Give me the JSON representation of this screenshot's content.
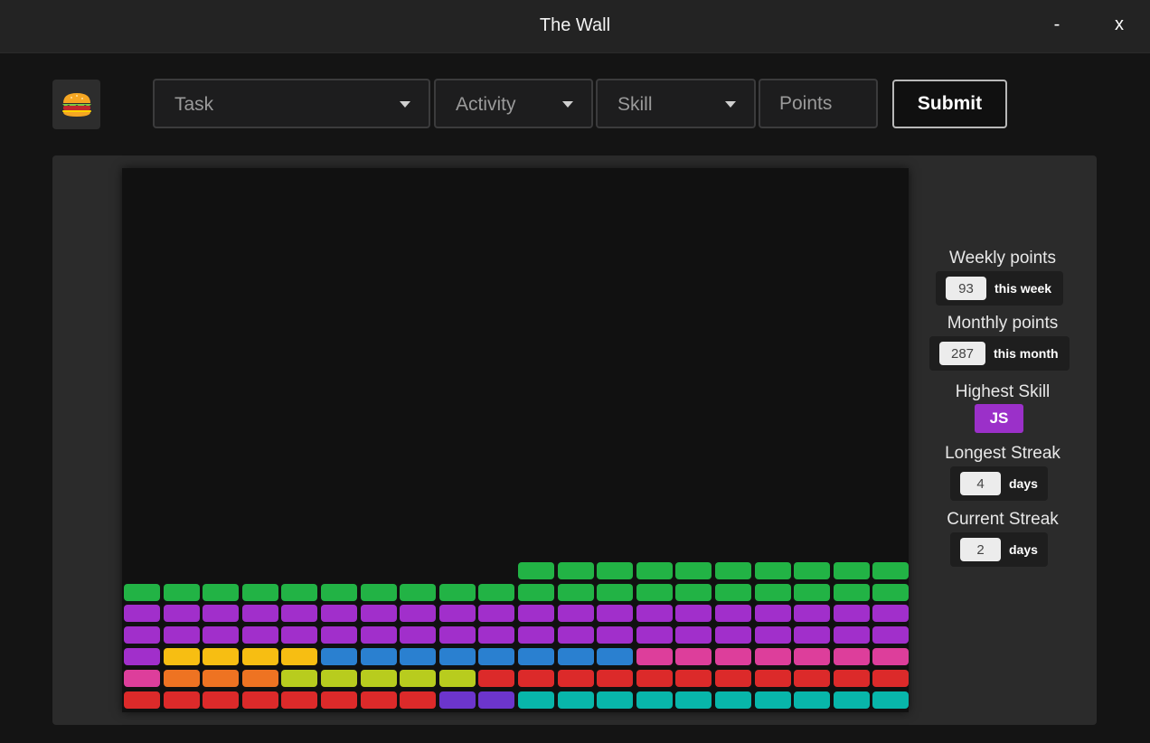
{
  "window": {
    "title": "The Wall",
    "minimize_label": "-",
    "close_label": "x"
  },
  "logo": {
    "icon": "burger-icon"
  },
  "form": {
    "task_label": "Task",
    "activity_label": "Activity",
    "skill_label": "Skill",
    "points_placeholder": "Points",
    "submit_label": "Submit"
  },
  "stats": {
    "weekly": {
      "label": "Weekly points",
      "value": "93",
      "unit": "this week"
    },
    "monthly": {
      "label": "Monthly points",
      "value": "287",
      "unit": "this month"
    },
    "highest_skill": {
      "label": "Highest Skill",
      "value": "JS",
      "color": "#9b30c9"
    },
    "longest_streak": {
      "label": "Longest Streak",
      "value": "4",
      "unit": "days"
    },
    "current_streak": {
      "label": "Current Streak",
      "value": "2",
      "unit": "days"
    }
  },
  "wall": {
    "columns": 20,
    "colors": {
      "G": "#22b345",
      "P": "#a12fcb",
      "Y": "#f7be12",
      "B": "#2a80d0",
      "K": "#dd3e9b",
      "O": "#ee7322",
      "L": "#b8cc1e",
      "R": "#dc2a2a",
      "V": "#6c35cc",
      "T": "#08b6aa"
    },
    "rows_bottom_to_top": [
      [
        "R",
        "R",
        "R",
        "R",
        "R",
        "R",
        "R",
        "R",
        "V",
        "V",
        "T",
        "T",
        "T",
        "T",
        "T",
        "T",
        "T",
        "T",
        "T",
        "T"
      ],
      [
        "K",
        "O",
        "O",
        "O",
        "L",
        "L",
        "L",
        "L",
        "L",
        "R",
        "R",
        "R",
        "R",
        "R",
        "R",
        "R",
        "R",
        "R",
        "R",
        "R"
      ],
      [
        "P",
        "Y",
        "Y",
        "Y",
        "Y",
        "B",
        "B",
        "B",
        "B",
        "B",
        "B",
        "B",
        "B",
        "K",
        "K",
        "K",
        "K",
        "K",
        "K",
        "K"
      ],
      [
        "P",
        "P",
        "P",
        "P",
        "P",
        "P",
        "P",
        "P",
        "P",
        "P",
        "P",
        "P",
        "P",
        "P",
        "P",
        "P",
        "P",
        "P",
        "P",
        "P"
      ],
      [
        "P",
        "P",
        "P",
        "P",
        "P",
        "P",
        "P",
        "P",
        "P",
        "P",
        "P",
        "P",
        "P",
        "P",
        "P",
        "P",
        "P",
        "P",
        "P",
        "P"
      ],
      [
        "G",
        "G",
        "G",
        "G",
        "G",
        "G",
        "G",
        "G",
        "G",
        "G",
        "G",
        "G",
        "G",
        "G",
        "G",
        "G",
        "G",
        "G",
        "G",
        "G"
      ],
      [
        null,
        null,
        null,
        null,
        null,
        null,
        null,
        null,
        null,
        null,
        "G",
        "G",
        "G",
        "G",
        "G",
        "G",
        "G",
        "G",
        "G",
        "G"
      ]
    ]
  }
}
